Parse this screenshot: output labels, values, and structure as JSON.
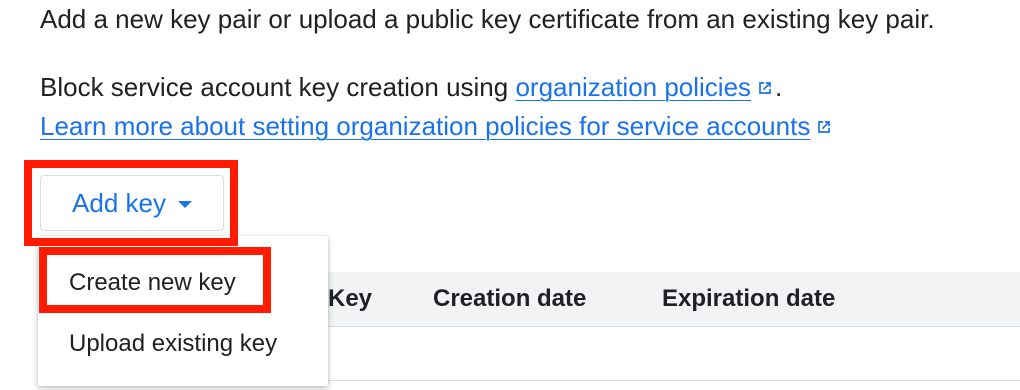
{
  "intro_text": "Add a new key pair or upload a public key certificate from an existing key pair.",
  "policy_notice": {
    "prefix": "Block service account key creation using ",
    "link_label": "organization policies",
    "suffix": "."
  },
  "learn_more_link": "Learn more about setting organization policies for service accounts",
  "add_key_button": {
    "label": "Add key",
    "icon": "caret-down-icon"
  },
  "dropdown": {
    "items": [
      {
        "label": "Create new key",
        "highlighted": true
      },
      {
        "label": "Upload existing key",
        "highlighted": false
      }
    ]
  },
  "table": {
    "columns": [
      "Key",
      "Creation date",
      "Expiration date"
    ]
  },
  "icons": {
    "external_link": "external-link-icon"
  },
  "colors": {
    "link": "#1a73e8",
    "highlight": "#ff1a00",
    "table_header_bg": "#f1f3f4"
  }
}
